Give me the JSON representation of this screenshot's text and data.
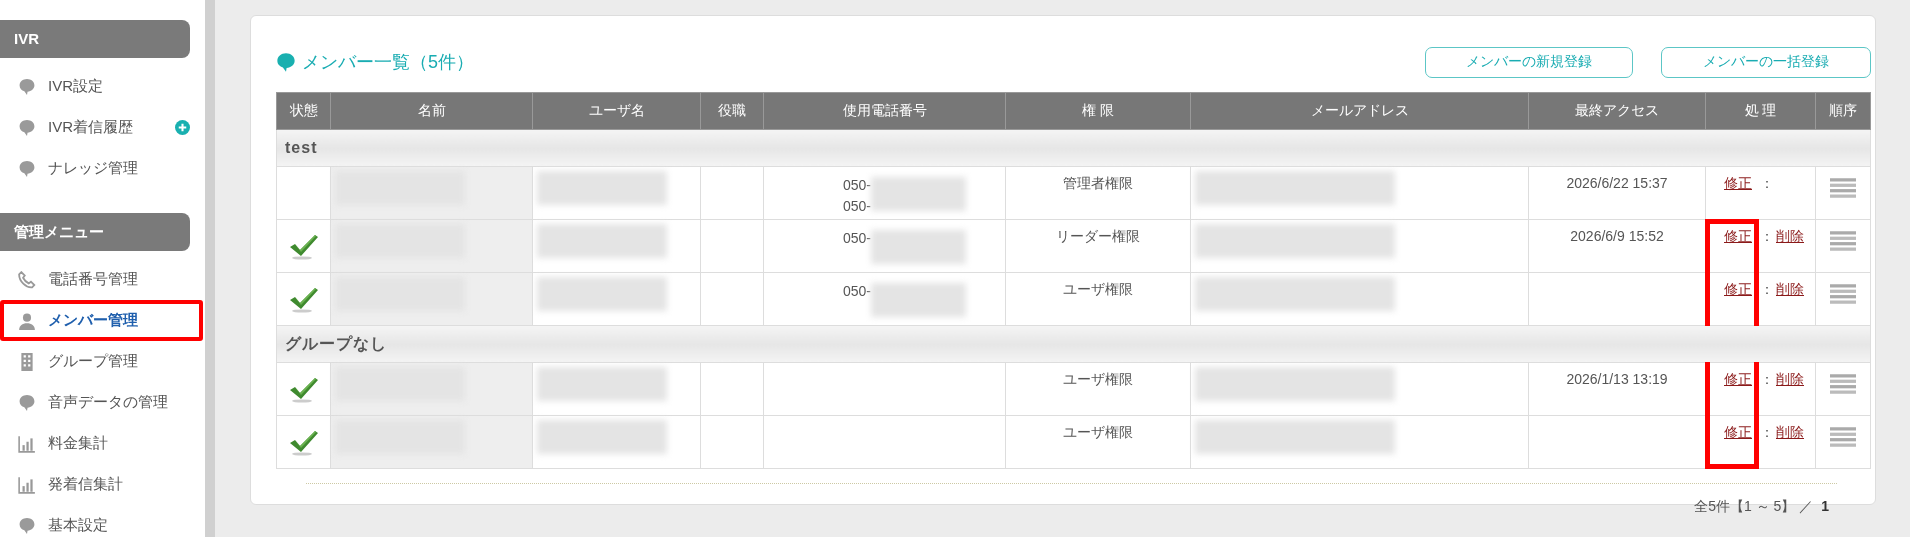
{
  "sidebar": {
    "sections": [
      {
        "title": "IVR",
        "items": [
          {
            "label": "IVR設定",
            "kind": "bubble",
            "selected": false,
            "highlighted": false,
            "add": false
          },
          {
            "label": "IVR着信履歴",
            "kind": "bubble",
            "selected": false,
            "highlighted": false,
            "add": true
          },
          {
            "label": "ナレッジ管理",
            "kind": "bubble",
            "selected": false,
            "highlighted": false,
            "add": false
          }
        ]
      },
      {
        "title": "管理メニュー",
        "items": [
          {
            "label": "電話番号管理",
            "kind": "phone",
            "selected": false,
            "highlighted": false,
            "add": false
          },
          {
            "label": "メンバー管理",
            "kind": "person",
            "selected": true,
            "highlighted": true,
            "add": false
          },
          {
            "label": "グループ管理",
            "kind": "building",
            "selected": false,
            "highlighted": false,
            "add": false
          },
          {
            "label": "音声データの管理",
            "kind": "bubble",
            "selected": false,
            "highlighted": false,
            "add": false
          },
          {
            "label": "料金集計",
            "kind": "chart",
            "selected": false,
            "highlighted": false,
            "add": false
          },
          {
            "label": "発着信集計",
            "kind": "chart",
            "selected": false,
            "highlighted": false,
            "add": false
          },
          {
            "label": "基本設定",
            "kind": "bubble",
            "selected": false,
            "highlighted": false,
            "add": false
          }
        ]
      }
    ]
  },
  "panel": {
    "title": "メンバー一覧（5件）",
    "buttons": [
      "メンバーの新規登録",
      "メンバーの一括登録"
    ]
  },
  "table": {
    "columns": [
      "状態",
      "名前",
      "ユーザ名",
      "役職",
      "使用電話番号",
      "権 限",
      "メールアドレス",
      "最終アクセス",
      "処 理",
      "順序"
    ],
    "groups": [
      {
        "name": "test",
        "rows": [
          {
            "active": false,
            "phones": [
              "050-",
              "050-"
            ],
            "role": "管理者権限",
            "last_access": "2026/6/22 15:37",
            "highlighted": false,
            "actions": [
              {
                "kind": "link",
                "text": "修正"
              },
              {
                "kind": "sep",
                "text": "："
              }
            ]
          },
          {
            "active": true,
            "phones": [
              "050-"
            ],
            "role": "リーダー権限",
            "last_access": "2026/6/9 15:52",
            "highlighted": true,
            "actions": [
              {
                "kind": "link",
                "text": "修正"
              },
              {
                "kind": "sep",
                "text": "："
              },
              {
                "kind": "link",
                "text": "削除"
              }
            ]
          },
          {
            "active": true,
            "phones": [
              "050-"
            ],
            "role": "ユーザ権限",
            "last_access": "",
            "highlighted": true,
            "actions": [
              {
                "kind": "link",
                "text": "修正"
              },
              {
                "kind": "sep",
                "text": "："
              },
              {
                "kind": "link",
                "text": "削除"
              }
            ]
          }
        ]
      },
      {
        "name": "グループなし",
        "rows": [
          {
            "active": true,
            "phones": [],
            "role": "ユーザ権限",
            "last_access": "2026/1/13 13:19",
            "highlighted": true,
            "actions": [
              {
                "kind": "link",
                "text": "修正"
              },
              {
                "kind": "sep",
                "text": "："
              },
              {
                "kind": "link",
                "text": "削除"
              }
            ]
          },
          {
            "active": true,
            "phones": [],
            "role": "ユーザ権限",
            "last_access": "",
            "highlighted": true,
            "actions": [
              {
                "kind": "link",
                "text": "修正"
              },
              {
                "kind": "sep",
                "text": "："
              },
              {
                "kind": "link",
                "text": "削除"
              }
            ]
          }
        ]
      }
    ]
  },
  "pagination": {
    "summary": "全5件【1 ～ 5】 ／",
    "page": "1"
  }
}
